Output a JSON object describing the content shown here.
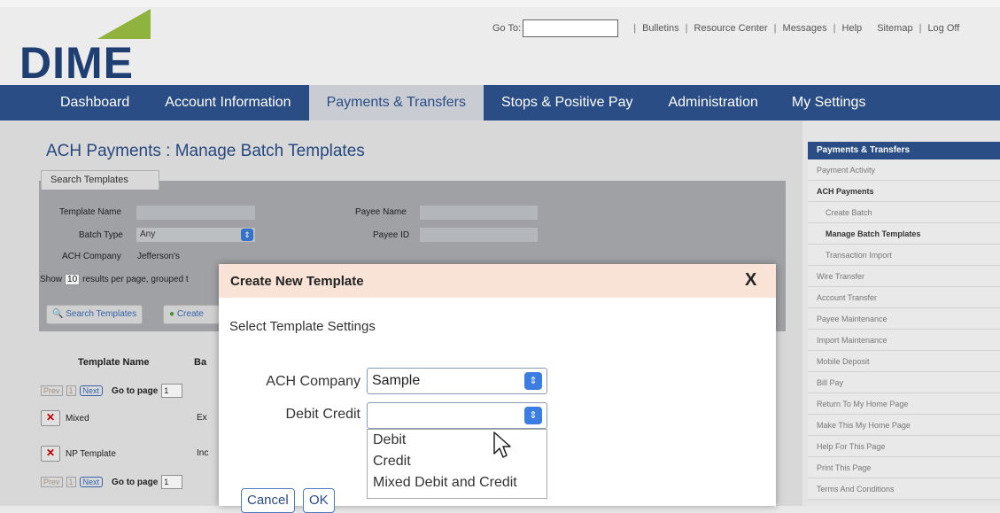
{
  "logo": {
    "text": "DIME"
  },
  "topbar": {
    "goto_label": "Go To:",
    "links": [
      "Bulletins",
      "Resource Center",
      "Messages",
      "Help",
      "Sitemap",
      "Log Off"
    ]
  },
  "nav": {
    "items": [
      "Dashboard",
      "Account Information",
      "Payments & Transfers",
      "Stops & Positive Pay",
      "Administration",
      "My Settings"
    ]
  },
  "page": {
    "title": "ACH Payments : Manage Batch Templates",
    "search_tab": "Search Templates",
    "template_name_label": "Template Name",
    "batch_type_label": "Batch Type",
    "batch_type_value": "Any",
    "ach_company_label": "ACH Company",
    "ach_company_value": "Jefferson's",
    "payee_name_label": "Payee Name",
    "payee_id_label": "Payee ID",
    "show_text_pre": "Show",
    "show_count": "10",
    "show_text_post": "results per page, grouped t",
    "search_button": "Search Templates",
    "create_button": "Create",
    "col_template_name": "Template Name",
    "col_b": "Ba",
    "pager": {
      "prev": "Prev",
      "page": "1",
      "next": "Next",
      "goto": "Go to page",
      "value": "1"
    },
    "rows": [
      {
        "name": "Mixed",
        "type": "Ex"
      },
      {
        "name": "NP Template",
        "type": "Inc"
      }
    ]
  },
  "dialog": {
    "title": "Create New Template",
    "close": "X",
    "subtitle": "Select Template Settings",
    "ach_company_label": "ACH Company",
    "ach_company_value": "Sample",
    "debit_credit_label": "Debit Credit",
    "debit_credit_value": "",
    "options": [
      "Debit",
      "Credit",
      "Mixed Debit and Credit"
    ],
    "cancel": "Cancel",
    "ok": "OK"
  },
  "sidebar": {
    "header": "Payments & Transfers",
    "items": [
      {
        "label": "Payment Activity",
        "style": ""
      },
      {
        "label": "ACH Payments",
        "style": "bold"
      },
      {
        "label": "Create Batch",
        "style": "sub"
      },
      {
        "label": "Manage Batch Templates",
        "style": "sub bold"
      },
      {
        "label": "Transaction Import",
        "style": "sub"
      },
      {
        "label": "Wire Transfer",
        "style": ""
      },
      {
        "label": "Account Transfer",
        "style": ""
      },
      {
        "label": "Payee Maintenance",
        "style": ""
      },
      {
        "label": "Import Maintenance",
        "style": ""
      },
      {
        "label": "Mobile Deposit",
        "style": ""
      },
      {
        "label": "Bill Pay",
        "style": ""
      },
      {
        "label": "Return To My Home Page",
        "style": ""
      },
      {
        "label": "Make This My Home Page",
        "style": ""
      },
      {
        "label": "Help For This Page",
        "style": ""
      },
      {
        "label": "Print This Page",
        "style": ""
      },
      {
        "label": "Terms And Conditions",
        "style": ""
      }
    ]
  },
  "colors": {
    "nav": "#2a4d86",
    "logo_green": "#8fb33d",
    "dialog_header": "#f9e3d7",
    "select_button": "#3b7de0"
  }
}
